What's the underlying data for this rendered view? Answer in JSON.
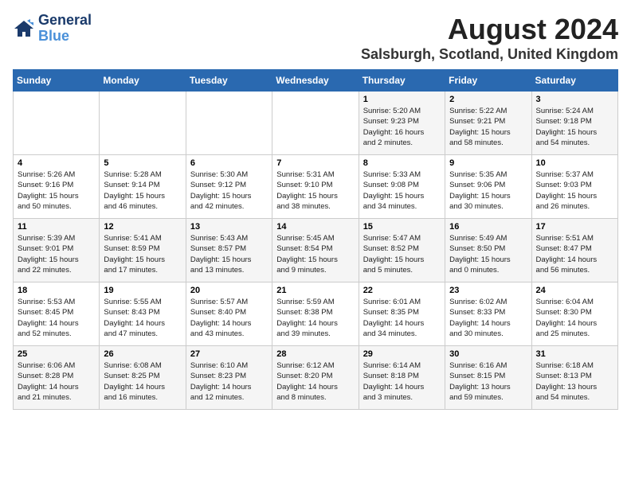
{
  "logo": {
    "line1": "General",
    "line2": "Blue"
  },
  "title": "August 2024",
  "subtitle": "Salsburgh, Scotland, United Kingdom",
  "days_of_week": [
    "Sunday",
    "Monday",
    "Tuesday",
    "Wednesday",
    "Thursday",
    "Friday",
    "Saturday"
  ],
  "weeks": [
    [
      {
        "day": "",
        "info": ""
      },
      {
        "day": "",
        "info": ""
      },
      {
        "day": "",
        "info": ""
      },
      {
        "day": "",
        "info": ""
      },
      {
        "day": "1",
        "info": "Sunrise: 5:20 AM\nSunset: 9:23 PM\nDaylight: 16 hours\nand 2 minutes."
      },
      {
        "day": "2",
        "info": "Sunrise: 5:22 AM\nSunset: 9:21 PM\nDaylight: 15 hours\nand 58 minutes."
      },
      {
        "day": "3",
        "info": "Sunrise: 5:24 AM\nSunset: 9:18 PM\nDaylight: 15 hours\nand 54 minutes."
      }
    ],
    [
      {
        "day": "4",
        "info": "Sunrise: 5:26 AM\nSunset: 9:16 PM\nDaylight: 15 hours\nand 50 minutes."
      },
      {
        "day": "5",
        "info": "Sunrise: 5:28 AM\nSunset: 9:14 PM\nDaylight: 15 hours\nand 46 minutes."
      },
      {
        "day": "6",
        "info": "Sunrise: 5:30 AM\nSunset: 9:12 PM\nDaylight: 15 hours\nand 42 minutes."
      },
      {
        "day": "7",
        "info": "Sunrise: 5:31 AM\nSunset: 9:10 PM\nDaylight: 15 hours\nand 38 minutes."
      },
      {
        "day": "8",
        "info": "Sunrise: 5:33 AM\nSunset: 9:08 PM\nDaylight: 15 hours\nand 34 minutes."
      },
      {
        "day": "9",
        "info": "Sunrise: 5:35 AM\nSunset: 9:06 PM\nDaylight: 15 hours\nand 30 minutes."
      },
      {
        "day": "10",
        "info": "Sunrise: 5:37 AM\nSunset: 9:03 PM\nDaylight: 15 hours\nand 26 minutes."
      }
    ],
    [
      {
        "day": "11",
        "info": "Sunrise: 5:39 AM\nSunset: 9:01 PM\nDaylight: 15 hours\nand 22 minutes."
      },
      {
        "day": "12",
        "info": "Sunrise: 5:41 AM\nSunset: 8:59 PM\nDaylight: 15 hours\nand 17 minutes."
      },
      {
        "day": "13",
        "info": "Sunrise: 5:43 AM\nSunset: 8:57 PM\nDaylight: 15 hours\nand 13 minutes."
      },
      {
        "day": "14",
        "info": "Sunrise: 5:45 AM\nSunset: 8:54 PM\nDaylight: 15 hours\nand 9 minutes."
      },
      {
        "day": "15",
        "info": "Sunrise: 5:47 AM\nSunset: 8:52 PM\nDaylight: 15 hours\nand 5 minutes."
      },
      {
        "day": "16",
        "info": "Sunrise: 5:49 AM\nSunset: 8:50 PM\nDaylight: 15 hours\nand 0 minutes."
      },
      {
        "day": "17",
        "info": "Sunrise: 5:51 AM\nSunset: 8:47 PM\nDaylight: 14 hours\nand 56 minutes."
      }
    ],
    [
      {
        "day": "18",
        "info": "Sunrise: 5:53 AM\nSunset: 8:45 PM\nDaylight: 14 hours\nand 52 minutes."
      },
      {
        "day": "19",
        "info": "Sunrise: 5:55 AM\nSunset: 8:43 PM\nDaylight: 14 hours\nand 47 minutes."
      },
      {
        "day": "20",
        "info": "Sunrise: 5:57 AM\nSunset: 8:40 PM\nDaylight: 14 hours\nand 43 minutes."
      },
      {
        "day": "21",
        "info": "Sunrise: 5:59 AM\nSunset: 8:38 PM\nDaylight: 14 hours\nand 39 minutes."
      },
      {
        "day": "22",
        "info": "Sunrise: 6:01 AM\nSunset: 8:35 PM\nDaylight: 14 hours\nand 34 minutes."
      },
      {
        "day": "23",
        "info": "Sunrise: 6:02 AM\nSunset: 8:33 PM\nDaylight: 14 hours\nand 30 minutes."
      },
      {
        "day": "24",
        "info": "Sunrise: 6:04 AM\nSunset: 8:30 PM\nDaylight: 14 hours\nand 25 minutes."
      }
    ],
    [
      {
        "day": "25",
        "info": "Sunrise: 6:06 AM\nSunset: 8:28 PM\nDaylight: 14 hours\nand 21 minutes."
      },
      {
        "day": "26",
        "info": "Sunrise: 6:08 AM\nSunset: 8:25 PM\nDaylight: 14 hours\nand 16 minutes."
      },
      {
        "day": "27",
        "info": "Sunrise: 6:10 AM\nSunset: 8:23 PM\nDaylight: 14 hours\nand 12 minutes."
      },
      {
        "day": "28",
        "info": "Sunrise: 6:12 AM\nSunset: 8:20 PM\nDaylight: 14 hours\nand 8 minutes."
      },
      {
        "day": "29",
        "info": "Sunrise: 6:14 AM\nSunset: 8:18 PM\nDaylight: 14 hours\nand 3 minutes."
      },
      {
        "day": "30",
        "info": "Sunrise: 6:16 AM\nSunset: 8:15 PM\nDaylight: 13 hours\nand 59 minutes."
      },
      {
        "day": "31",
        "info": "Sunrise: 6:18 AM\nSunset: 8:13 PM\nDaylight: 13 hours\nand 54 minutes."
      }
    ]
  ]
}
